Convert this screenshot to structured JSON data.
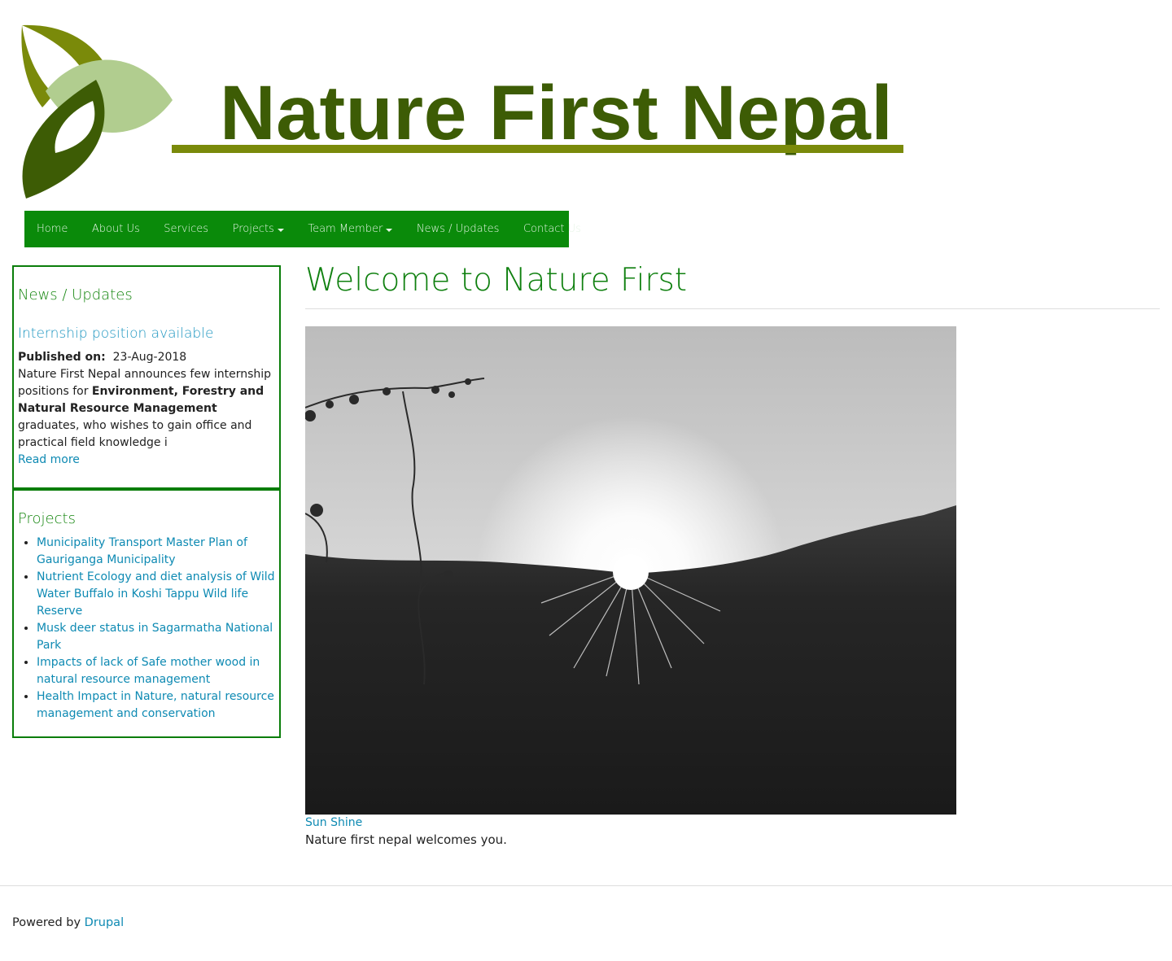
{
  "site": {
    "logo_title": "Nature First Nepal",
    "colors": {
      "logo_dark_green": "#3d5c05",
      "logo_olive": "#7a8a0a",
      "logo_light_green": "#b1cd8f",
      "nav_green": "#0a8a0a",
      "link_blue": "#0e8ab3",
      "heading_green": "#0f800f"
    }
  },
  "nav": {
    "items": [
      {
        "label": "Home"
      },
      {
        "label": "About Us"
      },
      {
        "label": "Services"
      },
      {
        "label": "Projects"
      },
      {
        "label": "Team Member"
      },
      {
        "label": "News / Updates"
      },
      {
        "label": "Contact Us"
      }
    ]
  },
  "sidebar": {
    "news": {
      "title": "News / Updates",
      "item_title": "Internship position available",
      "published_label": "Published on:",
      "published_date": "23-Aug-2018",
      "body_1": "Nature First Nepal announces few internship positions for ",
      "body_bold": "Environment, Forestry and Natural Resource Management",
      "body_2": " graduates, who wishes to gain office and practical field knowledge i",
      "read_more": "Read more"
    },
    "projects": {
      "title": "Projects",
      "items": [
        "Municipality Transport Master Plan of Gauriganga Municipality",
        "Nutrient Ecology and diet analysis of Wild Water Buffalo in Koshi Tappu Wild life Reserve",
        "Musk deer status in Sagarmatha National Park",
        "Impacts of lack of Safe mother wood in natural resource management",
        "Health Impact in Nature, natural resource management and conservation"
      ]
    }
  },
  "main": {
    "title": "Welcome to Nature First",
    "image_caption_link": "Sun Shine",
    "image_caption_text": "Nature first nepal welcomes you."
  },
  "footer": {
    "powered_by": "Powered by ",
    "link": "Drupal"
  }
}
